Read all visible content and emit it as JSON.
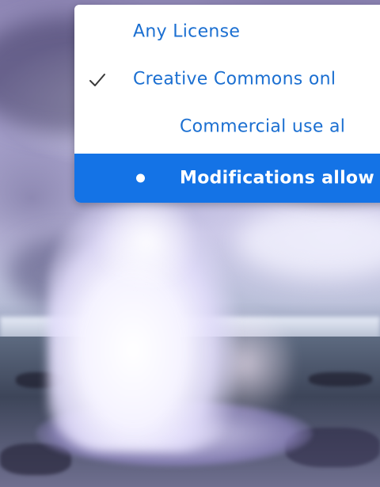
{
  "background": {
    "image_subject": "geyser-photo"
  },
  "license_menu": {
    "items": [
      {
        "label": "Any License",
        "checked": false,
        "indent": false,
        "highlighted": false
      },
      {
        "label": "Creative Commons onl",
        "checked": true,
        "indent": false,
        "highlighted": false
      },
      {
        "label": "Commercial use al",
        "checked": false,
        "indent": true,
        "highlighted": false
      },
      {
        "label": "Modifications allow",
        "checked": false,
        "indent": true,
        "highlighted": true,
        "marker": "bullet"
      }
    ],
    "colors": {
      "text": "#1b6fd1",
      "highlight_bg": "#1473e6",
      "highlight_text": "#ffffff",
      "menu_bg": "#ffffff"
    },
    "icons": {
      "checked_marker": "checkmark-icon",
      "highlight_marker": "bullet-icon"
    }
  }
}
